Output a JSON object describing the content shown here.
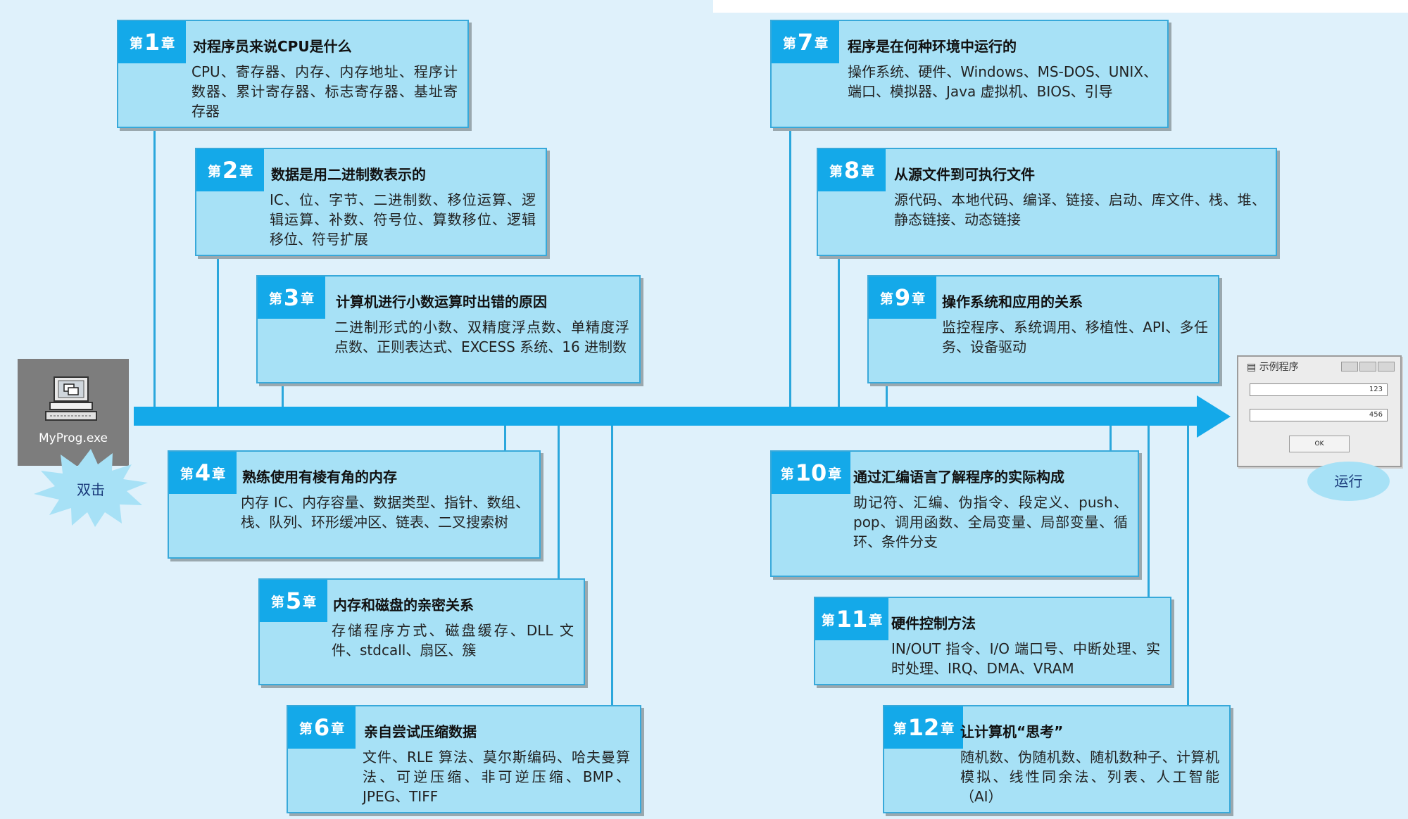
{
  "chapter_prefix": "第",
  "chapter_suffix": "章",
  "chapters": [
    {
      "num": "1",
      "title": "对程序员来说CPU是什么",
      "body": "CPU、寄存器、内存、内存地址、程序计数器、累计寄存器、标志寄存器、基址寄存器"
    },
    {
      "num": "2",
      "title": "数据是用二进制数表示的",
      "body": "IC、位、字节、二进制数、移位运算、逻辑运算、补数、符号位、算数移位、逻辑移位、符号扩展"
    },
    {
      "num": "3",
      "title": "计算机进行小数运算时出错的原因",
      "body": "二进制形式的小数、双精度浮点数、单精度浮点数、正则表达式、EXCESS 系统、16 进制数"
    },
    {
      "num": "4",
      "title": "熟练使用有棱有角的内存",
      "body": "内存 IC、内存容量、数据类型、指针、数组、栈、队列、环形缓冲区、链表、二叉搜索树"
    },
    {
      "num": "5",
      "title": "内存和磁盘的亲密关系",
      "body": "存储程序方式、磁盘缓存、DLL 文件、stdcall、扇区、簇"
    },
    {
      "num": "6",
      "title": "亲自尝试压缩数据",
      "body": "文件、RLE 算法、莫尔斯编码、哈夫曼算法、可逆压缩、非可逆压缩、BMP、JPEG、TIFF"
    },
    {
      "num": "7",
      "title": "程序是在何种环境中运行的",
      "body": "操作系统、硬件、Windows、MS-DOS、UNIX、端口、模拟器、Java 虚拟机、BIOS、引导"
    },
    {
      "num": "8",
      "title": "从源文件到可执行文件",
      "body": "源代码、本地代码、编译、链接、启动、库文件、栈、堆、静态链接、动态链接"
    },
    {
      "num": "9",
      "title": "操作系统和应用的关系",
      "body": "监控程序、系统调用、移植性、API、多任务、设备驱动"
    },
    {
      "num": "10",
      "title": "通过汇编语言了解程序的实际构成",
      "body": "助记符、汇编、伪指令、段定义、push、pop、调用函数、全局变量、局部变量、循环、条件分支"
    },
    {
      "num": "11",
      "title": "硬件控制方法",
      "body": "IN/OUT 指令、I/O 端口号、中断处理、实时处理、IRQ、DMA、VRAM"
    },
    {
      "num": "12",
      "title": "让计算机“思考”",
      "body": "随机数、伪随机数、随机数种子、计算机模拟、线性同余法、列表、人工智能（AI）"
    }
  ],
  "start": {
    "exe_label": "MyProg.exe",
    "action": "双击"
  },
  "end": {
    "window_title": "示例程序",
    "field1": "123",
    "field2": "456",
    "ok": "OK",
    "action": "运行"
  }
}
